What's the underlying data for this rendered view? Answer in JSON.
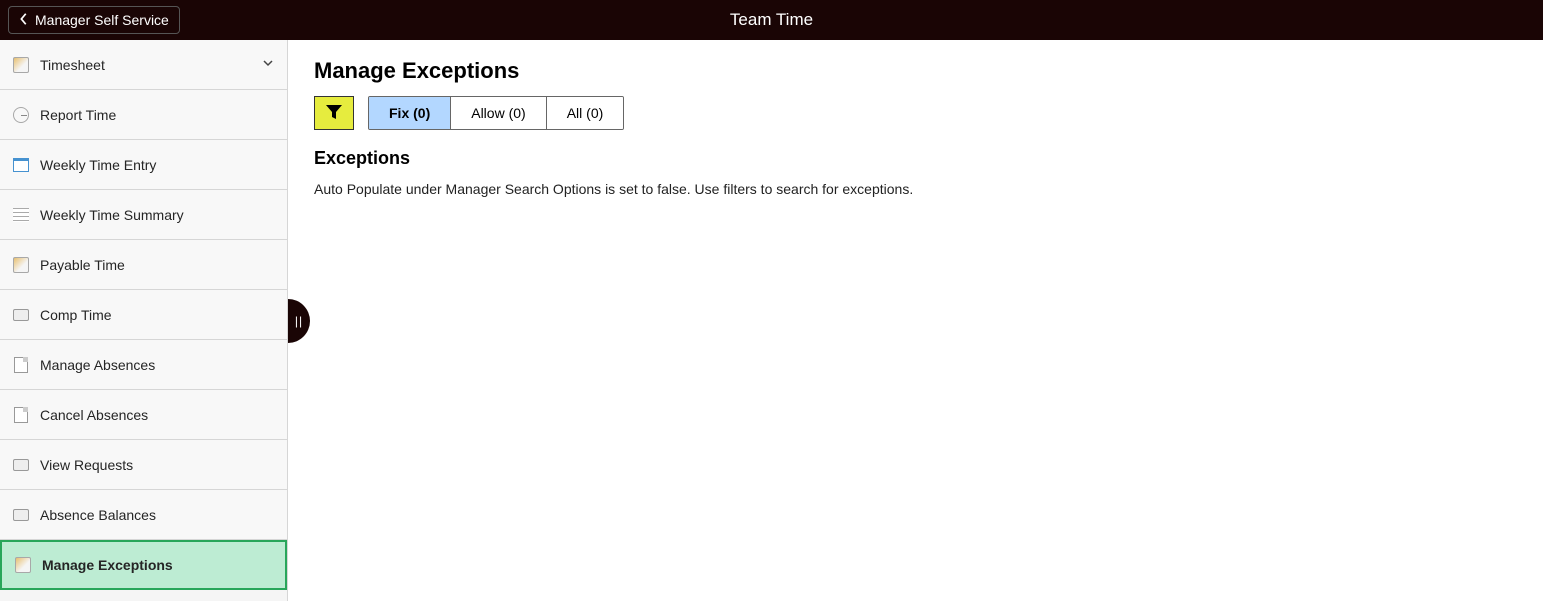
{
  "header": {
    "back_label": "Manager Self Service",
    "title": "Team Time"
  },
  "sidebar": {
    "items": [
      {
        "label": "Timesheet",
        "expandable": true
      },
      {
        "label": "Report Time"
      },
      {
        "label": "Weekly Time Entry"
      },
      {
        "label": "Weekly Time Summary"
      },
      {
        "label": "Payable Time"
      },
      {
        "label": "Comp Time"
      },
      {
        "label": "Manage Absences"
      },
      {
        "label": "Cancel Absences"
      },
      {
        "label": "View Requests"
      },
      {
        "label": "Absence Balances"
      },
      {
        "label": "Manage Exceptions",
        "selected": true
      }
    ]
  },
  "main": {
    "page_title": "Manage Exceptions",
    "tabs": [
      {
        "label": "Fix (0)",
        "active": true
      },
      {
        "label": "Allow (0)"
      },
      {
        "label": "All (0)"
      }
    ],
    "section_title": "Exceptions",
    "info_text": "Auto Populate under Manager Search Options is set to false. Use filters to search for exceptions."
  }
}
